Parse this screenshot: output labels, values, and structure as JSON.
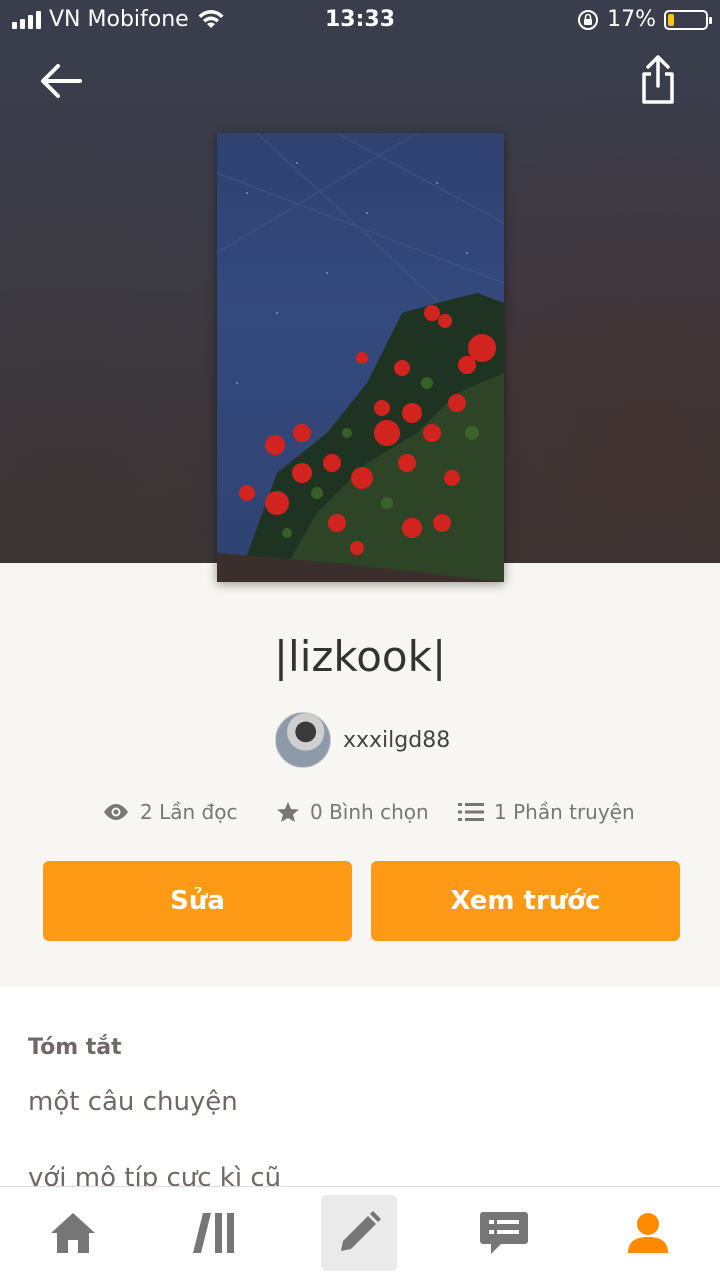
{
  "status_bar": {
    "carrier": "VN Mobifone",
    "time": "13:33",
    "battery": "17%",
    "battery_level": 0.17
  },
  "story": {
    "title": "|lizkook|",
    "author": "xxxilgd88"
  },
  "stats": {
    "reads": "2 Lần đọc",
    "votes": "0 Bình chọn",
    "parts": "1 Phần truyện"
  },
  "actions": {
    "edit_label": "Sửa",
    "preview_label": "Xem trước"
  },
  "summary": {
    "label": "Tóm tắt",
    "line1": "một câu chuyện",
    "line2": "với mô típ cực kì cũ"
  },
  "colors": {
    "accent": "#ff9a17",
    "active_nav": "#ff8a00"
  },
  "icons": [
    "back-arrow-icon",
    "share-icon",
    "eye-icon",
    "star-icon",
    "list-icon",
    "home-icon",
    "library-icon",
    "pencil-icon",
    "message-icon",
    "profile-icon"
  ]
}
